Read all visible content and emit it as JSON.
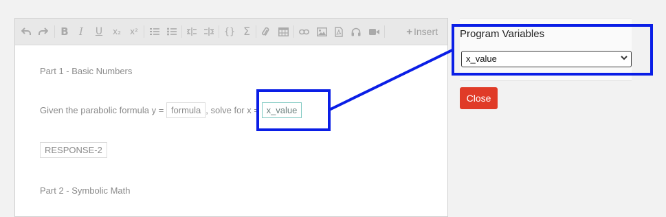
{
  "toolbar": {
    "buttons": [
      {
        "name": "undo-icon"
      },
      {
        "name": "redo-icon"
      },
      {
        "name": "bold-icon"
      },
      {
        "name": "italic-icon"
      },
      {
        "name": "underline-icon"
      },
      {
        "name": "subscript-icon"
      },
      {
        "name": "superscript-icon"
      },
      {
        "name": "ordered-list-icon"
      },
      {
        "name": "bullet-list-icon"
      },
      {
        "name": "indent-left-icon"
      },
      {
        "name": "indent-right-icon"
      },
      {
        "name": "code-braces-icon"
      },
      {
        "name": "sigma-icon"
      },
      {
        "name": "attachment-icon"
      },
      {
        "name": "table-icon"
      },
      {
        "name": "link-icon"
      },
      {
        "name": "image-icon"
      },
      {
        "name": "pdf-icon"
      },
      {
        "name": "audio-icon"
      },
      {
        "name": "video-icon"
      }
    ],
    "glyphs": {
      "bold": "B",
      "italic": "I",
      "underline": "U",
      "subscript": "x₂",
      "superscript": "x²",
      "code": "{}",
      "sigma": "Σ"
    },
    "insert_label": "Insert"
  },
  "editor": {
    "part1_heading": "Part 1 - Basic Numbers",
    "question_prefix": "Given the parabolic formula y =",
    "formula_chip": "formula",
    "question_middle": ", solve for x =",
    "variable_chip": "x_value",
    "response_chip": "RESPONSE-2",
    "part2_heading": "Part 2 - Symbolic Math"
  },
  "panel": {
    "title": "Program Variables",
    "selected_variable": "x_value"
  },
  "close_label": "Close",
  "colors": {
    "highlight": "#0a1ee6",
    "close_button": "#e03b27",
    "chip_selected_border": "#7fc9c2"
  }
}
